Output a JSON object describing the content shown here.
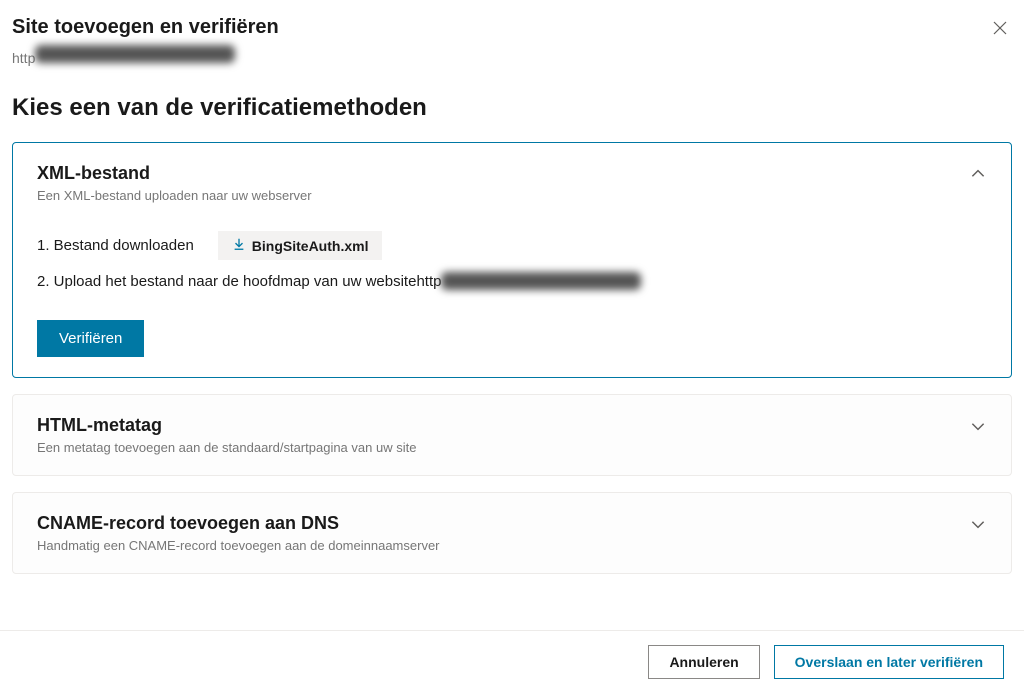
{
  "dialog": {
    "title": "Site toevoegen en verifiëren",
    "site_url_prefix": "http"
  },
  "section": {
    "heading": "Kies een van de verificatiemethoden"
  },
  "methods": {
    "xml": {
      "title": "XML-bestand",
      "subtitle": "Een XML-bestand uploaden naar uw webserver",
      "step1": "1. Bestand downloaden",
      "download_label": "BingSiteAuth.xml",
      "step2_part1": "2. Upload het bestand naar de hoofdmap van uw website",
      "step2_part2": "http",
      "verify_label": "Verifiëren"
    },
    "meta": {
      "title": "HTML-metatag",
      "subtitle": "Een metatag toevoegen aan de standaard/startpagina van uw site"
    },
    "cname": {
      "title": "CNAME-record toevoegen aan DNS",
      "subtitle": "Handmatig een CNAME-record toevoegen aan de domeinnaamserver"
    }
  },
  "footer": {
    "cancel": "Annuleren",
    "skip": "Overslaan en later verifiëren"
  }
}
